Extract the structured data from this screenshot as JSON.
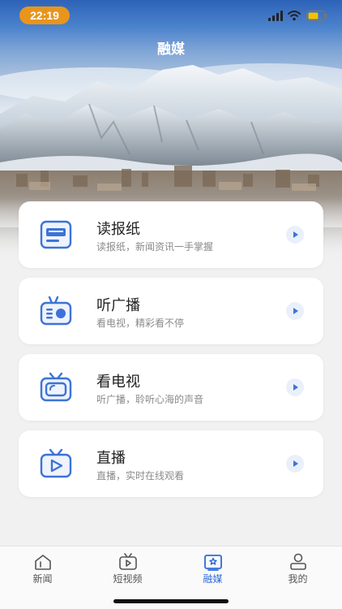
{
  "status_bar": {
    "time": "22:19",
    "icons": [
      "signal-icon",
      "wifi-icon",
      "battery-icon"
    ]
  },
  "header": {
    "title": "融媒"
  },
  "cards": [
    {
      "title": "读报纸",
      "subtitle": "读报纸，新闻资讯一手掌握",
      "icon": "newspaper-icon"
    },
    {
      "title": "听广播",
      "subtitle": "看电视，精彩看不停",
      "icon": "radio-icon"
    },
    {
      "title": "看电视",
      "subtitle": "听广播，聆听心海的声音",
      "icon": "tv-icon"
    },
    {
      "title": "直播",
      "subtitle": "直播，实时在线观看",
      "icon": "live-icon"
    }
  ],
  "bottom_nav": [
    {
      "label": "新闻",
      "icon": "news-icon",
      "active": false
    },
    {
      "label": "短视频",
      "icon": "short-video-icon",
      "active": false
    },
    {
      "label": "融媒",
      "icon": "media-icon",
      "active": true
    },
    {
      "label": "我的",
      "icon": "profile-icon",
      "active": false
    }
  ],
  "colors": {
    "accent": "#2e6ad8",
    "time_pill": "#e8951c",
    "icon_stroke": "#3d73d6",
    "icon_fill": "#eef3fc"
  }
}
